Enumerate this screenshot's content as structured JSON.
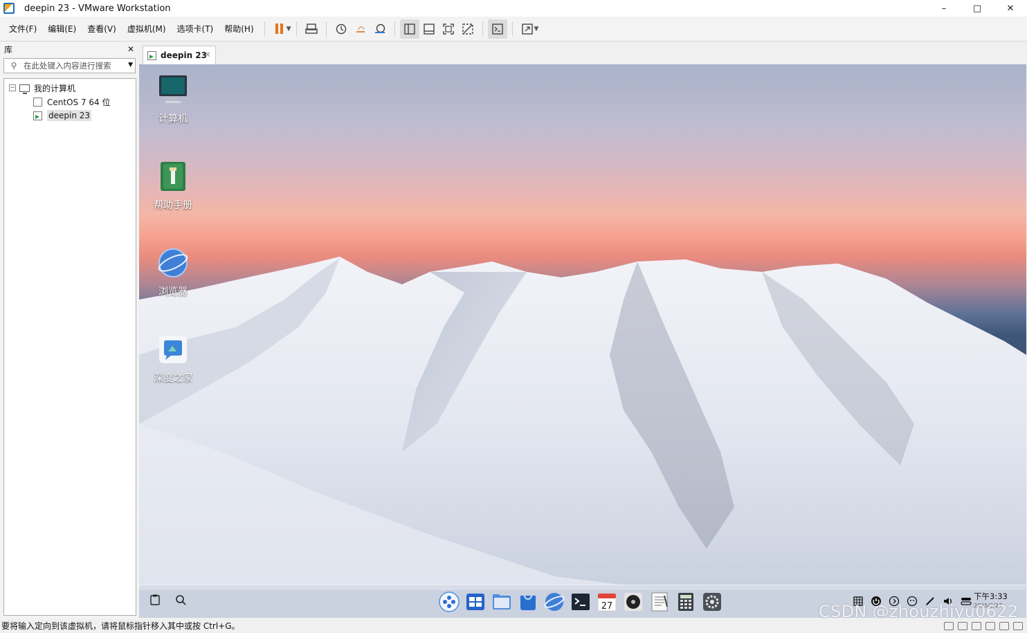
{
  "window": {
    "title": "deepin 23 - VMware Workstation",
    "minimize": "–",
    "maximize": "□",
    "close": "✕"
  },
  "menu": [
    "文件(F)",
    "编辑(E)",
    "查看(V)",
    "虚拟机(M)",
    "选项卡(T)",
    "帮助(H)"
  ],
  "toolbar_icons": [
    "pause-icon",
    "send-ctrl-alt-del-icon",
    "snapshot-take-icon",
    "snapshot-revert-icon",
    "snapshot-manager-icon",
    "library-view-icon",
    "thumbnail-bar-icon",
    "full-screen-icon",
    "unity-icon",
    "console-view-icon",
    "stretch-guest-icon"
  ],
  "library": {
    "title": "库",
    "close": "✕",
    "search_placeholder": "在此处键入内容进行搜索",
    "tree_toggle": "−",
    "root": "我的计算机",
    "vms": [
      {
        "name": "CentOS 7 64 位",
        "running": false
      },
      {
        "name": "deepin 23",
        "running": true,
        "selected": true
      }
    ]
  },
  "tab": {
    "label": "deepin 23",
    "close": "✕"
  },
  "desktop": {
    "icons": [
      {
        "label": "计算机",
        "icon": "computer-icon"
      },
      {
        "label": "帮助手册",
        "icon": "manual-icon"
      },
      {
        "label": "浏览器",
        "icon": "browser-icon"
      },
      {
        "label": "深度之家",
        "icon": "deepin-home-icon"
      }
    ]
  },
  "dock": {
    "left_icons": [
      "clipboard-icon",
      "search-icon"
    ],
    "apps": [
      "launcher-icon",
      "multitask-view-icon",
      "file-manager-icon",
      "app-store-icon",
      "browser-icon",
      "terminal-icon",
      "calendar-icon",
      "music-icon",
      "text-editor-icon",
      "calculator-icon",
      "settings-icon"
    ],
    "calendar_day": "27",
    "tray": [
      "keyboard-icon",
      "power-icon",
      "media-icon",
      "notification-icon",
      "pen-icon",
      "volume-icon",
      "network-icon"
    ],
    "time": "下午3:33",
    "date": "2025/2/27"
  },
  "statusbar": {
    "message": "要将输入定向到该虚拟机，请将鼠标指针移入其中或按 Ctrl+G。"
  },
  "watermark": "CSDN @zhouzhiyu0622"
}
